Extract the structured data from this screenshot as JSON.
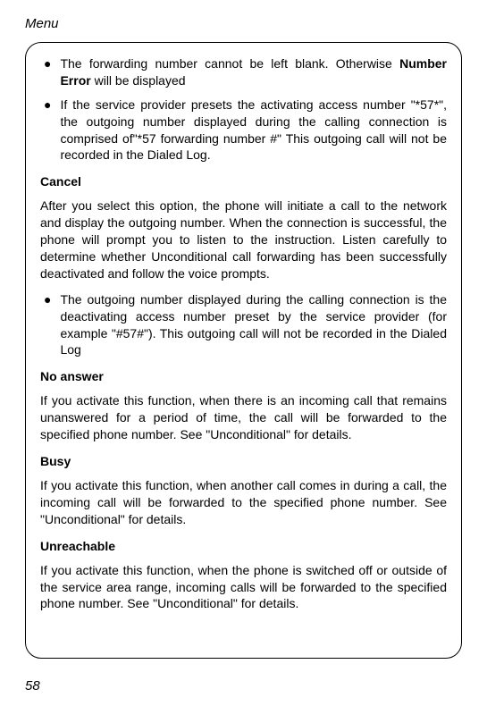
{
  "header": "Menu",
  "bullet1_part1": "The forwarding number cannot be left blank. Otherwise ",
  "bullet1_bold": "Number Error",
  "bullet1_part2": " will be displayed",
  "bullet2": "If the service provider presets the activating access number \"*57*\", the outgoing number displayed during the calling connection is comprised of\"*57 forwarding number #\" This outgoing call will not be recorded in the Dialed Log.",
  "cancel_heading": "Cancel",
  "cancel_para": "After you select this option, the phone will initiate a call to the network and display the outgoing number. When the connection is successful, the phone will prompt you to listen to the instruction. Listen carefully to determine whether Unconditional call forwarding has been successfully deactivated and follow the voice prompts.",
  "bullet3": "The outgoing number displayed during the calling connection is the deactivating access number preset by the service provider (for example \"#57#\"). This outgoing call will not be recorded in the Dialed Log",
  "noanswer_heading": "No answer",
  "noanswer_para": "If you activate this function, when there is an incoming call that remains unanswered for a period of time, the call will be forwarded to the specified phone number. See \"Unconditional\" for details.",
  "busy_heading": "Busy",
  "busy_para": "If you activate this function, when another call comes in during a call, the incoming call will be forwarded to the specified phone number. See \"Unconditional\" for details.",
  "unreachable_heading": "Unreachable",
  "unreachable_para": "If you activate this function, when the phone is switched off or outside of the service area range, incoming calls will be forwarded to the specified phone number. See \"Unconditional\" for details.",
  "page_number": "58",
  "bullet_symbol": "●"
}
